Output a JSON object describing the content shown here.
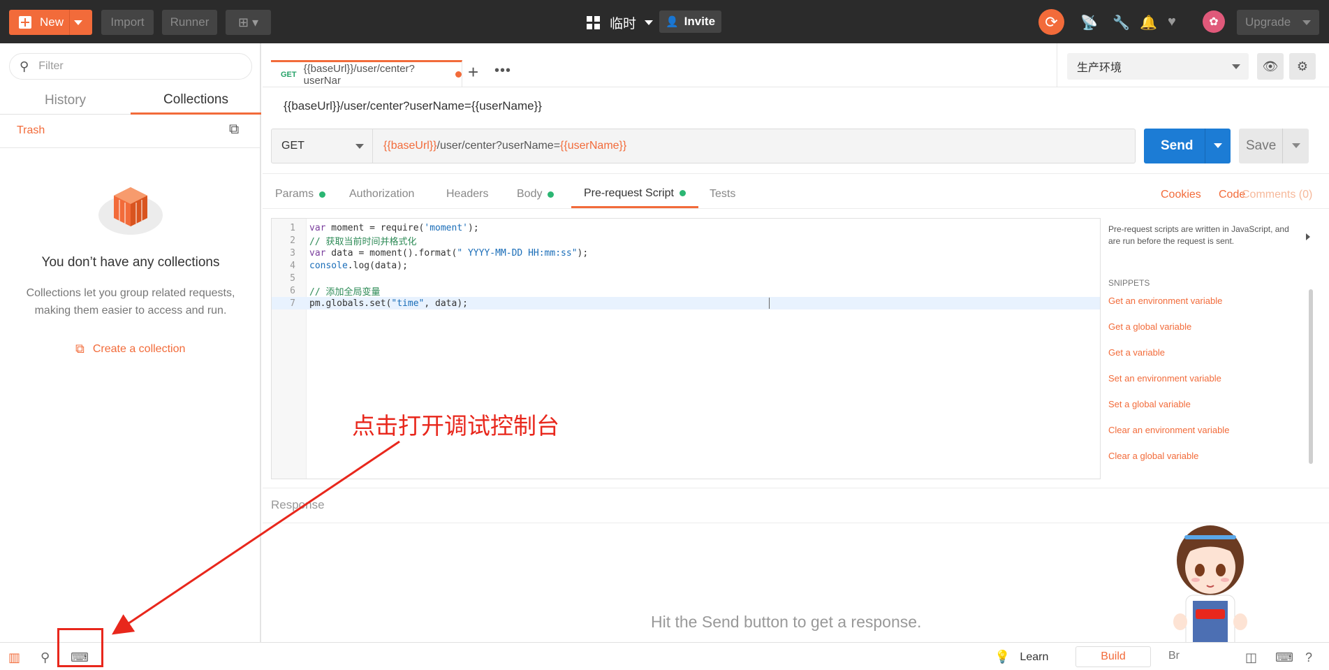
{
  "topbar": {
    "new_label": "New",
    "import_label": "Import",
    "runner_label": "Runner",
    "workspace_label": "临时",
    "invite_label": "Invite",
    "upgrade_label": "Upgrade",
    "accent_color": "#f26b3a"
  },
  "sidebar": {
    "filter_placeholder": "Filter",
    "tabs": [
      "History",
      "Collections"
    ],
    "active_tab": "Collections",
    "trash_label": "Trash",
    "empty_title": "You don’t have any collections",
    "empty_desc": "Collections let you group related requests, making them easier to access and run.",
    "create_label": "Create a collection"
  },
  "request_tab": {
    "method": "GET",
    "title": "{{baseUrl}}/user/center?userNar"
  },
  "environment": {
    "selected": "生产环境"
  },
  "request": {
    "name": "{{baseUrl}}/user/center?userName={{userName}}",
    "method": "GET",
    "url_var1": "{{baseUrl}}",
    "url_path": "/user/center?userName=",
    "url_var2": "{{userName}}",
    "send_label": "Send",
    "save_label": "Save"
  },
  "param_tabs": {
    "params": "Params",
    "authorization": "Authorization",
    "headers": "Headers",
    "body": "Body",
    "prerequest": "Pre-request Script",
    "tests": "Tests",
    "active": "Pre-request Script"
  },
  "right_links": {
    "cookies": "Cookies",
    "code": "Code",
    "comments": "Comments (0)"
  },
  "editor": {
    "lines": [
      "var moment = require('moment');",
      "// 获取当前时间并格式化",
      "var data = moment().format(\" YYYY-MM-DD HH:mm:ss\");",
      "console.log(data);",
      "",
      "// 添加全局变量",
      "pm.globals.set(\"time\", data);"
    ],
    "line_numbers": [
      "1",
      "2",
      "3",
      "4",
      "5",
      "6",
      "7"
    ],
    "current_line": 7
  },
  "snippets": {
    "description": "Pre-request scripts are written in JavaScript, and are run before the request is sent.",
    "heading": "SNIPPETS",
    "items": [
      "Get an environment variable",
      "Get a global variable",
      "Get a variable",
      "Set an environment variable",
      "Set a global variable",
      "Clear an environment variable",
      "Clear a global variable"
    ]
  },
  "response": {
    "label": "Response",
    "hint": "Hit the Send button to get a response."
  },
  "annotation": {
    "text": "点击打开调试控制台",
    "color": "#e8271c"
  },
  "statusbar": {
    "learn_label": "Learn",
    "build_label": "Build",
    "browse_label": "Br"
  }
}
